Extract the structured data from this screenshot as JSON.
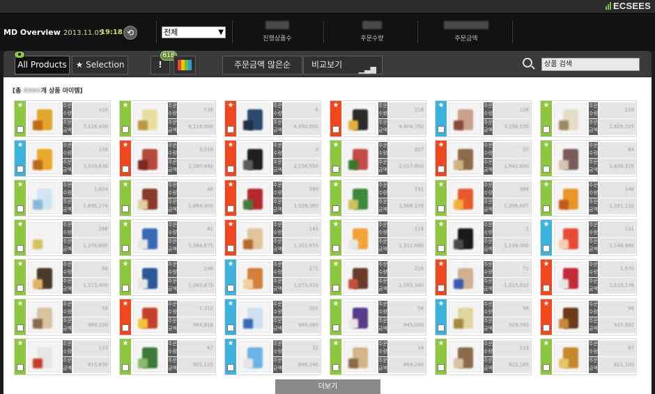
{
  "brand": {
    "logo_text": "ECSEES",
    "accent": "#7cc63a"
  },
  "header": {
    "title": "MD Overview",
    "date": "2013.11.05",
    "time": "19:18",
    "filter_value": "전체",
    "stats": [
      {
        "label": "진행상품수"
      },
      {
        "label": "주문수량"
      },
      {
        "label": "주문금액"
      }
    ]
  },
  "toolbar": {
    "tab_all": "All Products",
    "tab_selection": "★ Selection",
    "alert_badge": "618",
    "sort_label": "주문금액 많은순",
    "compare_label": "비교보기",
    "search_value": "상품 검색",
    "palette_colors": [
      "#e94b2a",
      "#f2c200",
      "#6cbf3c",
      "#2e9fd6"
    ]
  },
  "content": {
    "count_prefix": "[총 ",
    "count_suffix": "개 상품 아이템]",
    "more_label": "더보기",
    "row_labels": [
      "주문수량",
      "주문금액"
    ],
    "flag_colors": {
      "green": "#8dc63f",
      "red": "#f0471e",
      "blue": "#3bb3dc"
    },
    "items": [
      {
        "flag": "green",
        "qty": "318",
        "amount": "7,228,430",
        "c1": "#e2a62a",
        "c2": "#c46a1a"
      },
      {
        "flag": "green",
        "qty": "138",
        "amount": "6,118,000",
        "c1": "#e8e0a0",
        "c2": "#b89a40"
      },
      {
        "flag": "red",
        "qty": "6",
        "amount": "4,950,000",
        "c1": "#2b4a6b",
        "c2": "#1f2f45"
      },
      {
        "flag": "red",
        "qty": "218",
        "amount": "4,404,750",
        "c1": "#2a2a2a",
        "c2": "#e3b23c"
      },
      {
        "flag": "blue",
        "qty": "128",
        "amount": "3,298,530",
        "c1": "#c9a08a",
        "c2": "#8a4a3a"
      },
      {
        "flag": "green",
        "qty": "218",
        "amount": "2,826,225",
        "c1": "#e6dcc8",
        "c2": "#9c8a64"
      },
      {
        "flag": "blue",
        "qty": "116",
        "amount": "2,533,830",
        "c1": "#e8a82a",
        "c2": "#b86a1a"
      },
      {
        "flag": "red",
        "qty": "3,518",
        "amount": "2,260,492",
        "c1": "#b44a3a",
        "c2": "#7a2a22"
      },
      {
        "flag": "red",
        "qty": "3",
        "amount": "2,150,550",
        "c1": "#1f1f1f",
        "c2": "#5a5a5a"
      },
      {
        "flag": "green",
        "qty": "207",
        "amount": "2,017,800",
        "c1": "#c44a4a",
        "c2": "#3a7a2a"
      },
      {
        "flag": "red",
        "qty": "37",
        "amount": "1,842,600",
        "c1": "#8a6a4a",
        "c2": "#d0b080"
      },
      {
        "flag": "green",
        "qty": "84",
        "amount": "1,836,315",
        "c1": "#7a5a5a",
        "c2": "#d6c4b0"
      },
      {
        "flag": "green",
        "qty": "1,824",
        "amount": "1,695,274",
        "c1": "#cfe6f2",
        "c2": "#8ab8d6"
      },
      {
        "flag": "green",
        "qty": "48",
        "amount": "1,664,400",
        "c1": "#8a3a2a",
        "c2": "#e0d0a0"
      },
      {
        "flag": "red",
        "qty": "389",
        "amount": "1,526,360",
        "c1": "#b42a2a",
        "c2": "#4a7a3a"
      },
      {
        "flag": "green",
        "qty": "191",
        "amount": "1,566,120",
        "c1": "#3a8a3a",
        "c2": "#d0c060"
      },
      {
        "flag": "green",
        "qty": "396",
        "amount": "1,398,607",
        "c1": "#e85a2a",
        "c2": "#f2b23a"
      },
      {
        "flag": "green",
        "qty": "148",
        "amount": "1,391,110",
        "c1": "#e8962a",
        "c2": "#c45a1a"
      },
      {
        "flag": "green",
        "qty": "266",
        "amount": "1,376,695",
        "c1": "#f2f2f2",
        "c2": "#d6c060"
      },
      {
        "flag": "green",
        "qty": "81",
        "amount": "1,364,675",
        "c1": "#3a6ab4",
        "c2": "#e6e6e6"
      },
      {
        "flag": "red",
        "qty": "145",
        "amount": "1,352,655",
        "c1": "#e2c49a",
        "c2": "#b46a2a"
      },
      {
        "flag": "green",
        "qty": "119",
        "amount": "1,312,680",
        "c1": "#f2a23a",
        "c2": "#e6e6e6"
      },
      {
        "flag": "green",
        "qty": "1",
        "amount": "1,149,000",
        "c1": "#1a1a1a",
        "c2": "#4a4a4a"
      },
      {
        "flag": "blue",
        "qty": "131",
        "amount": "1,148,860",
        "c1": "#e84a3a",
        "c2": "#f2d0b0"
      },
      {
        "flag": "green",
        "qty": "56",
        "amount": "1,113,400",
        "c1": "#4a3a2a",
        "c2": "#e6b26a"
      },
      {
        "flag": "green",
        "qty": "146",
        "amount": "1,093,875",
        "c1": "#2a5a9a",
        "c2": "#e6e6e6"
      },
      {
        "flag": "blue",
        "qty": "171",
        "amount": "1,075,410",
        "c1": "#d4803a",
        "c2": "#f0d0a0"
      },
      {
        "flag": "green",
        "qty": "216",
        "amount": "1,055,340",
        "c1": "#6a3a2a",
        "c2": "#c4503a"
      },
      {
        "flag": "red",
        "qty": "71",
        "amount": "1,015,910",
        "c1": "#d0b090",
        "c2": "#3a5ab4"
      },
      {
        "flag": "red",
        "qty": "1,570",
        "amount": "1,010,276",
        "c1": "#c42a3a",
        "c2": "#e6e6e6"
      },
      {
        "flag": "green",
        "qty": "18",
        "amount": "989,100",
        "c1": "#d6c4a0",
        "c2": "#8a6a4a"
      },
      {
        "flag": "red",
        "qty": "1,312",
        "amount": "984,816",
        "c1": "#c4402a",
        "c2": "#f2c23a"
      },
      {
        "flag": "blue",
        "qty": "201",
        "amount": "984,060",
        "c1": "#cfe0f2",
        "c2": "#3a6ab4"
      },
      {
        "flag": "green",
        "qty": "58",
        "amount": "945,000",
        "c1": "#5a3a8a",
        "c2": "#e6e6e6"
      },
      {
        "flag": "blue",
        "qty": "96",
        "amount": "929,745",
        "c1": "#e0d6a0",
        "c2": "#a08a40"
      },
      {
        "flag": "red",
        "qty": "98",
        "amount": "915,892",
        "c1": "#6a3a1a",
        "c2": "#c48a3a"
      },
      {
        "flag": "green",
        "qty": "133",
        "amount": "915,630",
        "c1": "#e6e6e6",
        "c2": "#c4402a"
      },
      {
        "flag": "green",
        "qty": "67",
        "amount": "901,125",
        "c1": "#3a7a3a",
        "c2": "#8ab86a"
      },
      {
        "flag": "blue",
        "qty": "32",
        "amount": "886,240",
        "c1": "#6ab4e6",
        "c2": "#e6e6e6"
      },
      {
        "flag": "green",
        "qty": "14",
        "amount": "864,240",
        "c1": "#d6b48a",
        "c2": "#8a6a4a"
      },
      {
        "flag": "green",
        "qty": "119",
        "amount": "822,185",
        "c1": "#8a6a4a",
        "c2": "#d6c4a0"
      },
      {
        "flag": "green",
        "qty": "87",
        "amount": "821,100",
        "c1": "#c48a2a",
        "c2": "#e6c46a"
      }
    ]
  }
}
